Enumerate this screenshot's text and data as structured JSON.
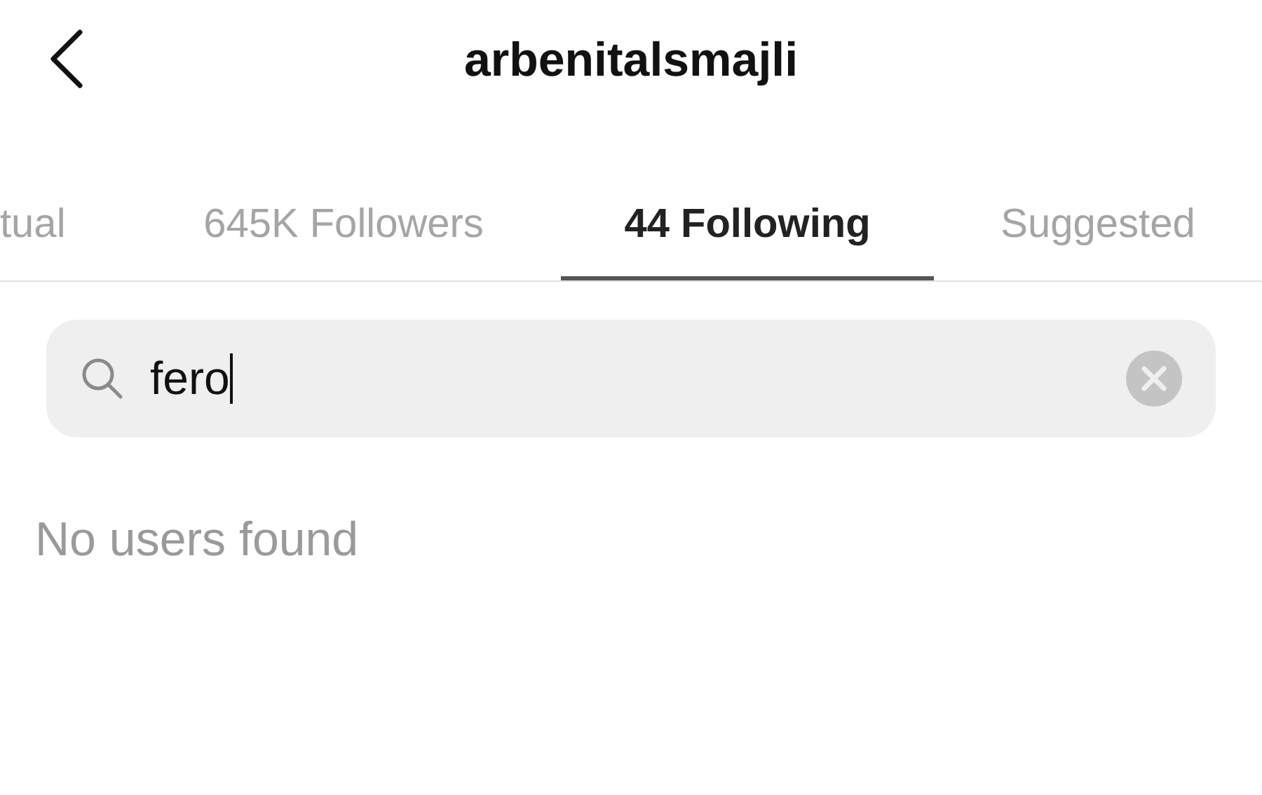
{
  "header": {
    "title": "arbenitalsmajli"
  },
  "tabs": [
    {
      "label": "tual",
      "selected": false
    },
    {
      "label": "645K Followers",
      "selected": false
    },
    {
      "label": "44 Following",
      "selected": true
    },
    {
      "label": "Suggested",
      "selected": false
    }
  ],
  "search": {
    "value": "fero"
  },
  "message": "No users found"
}
